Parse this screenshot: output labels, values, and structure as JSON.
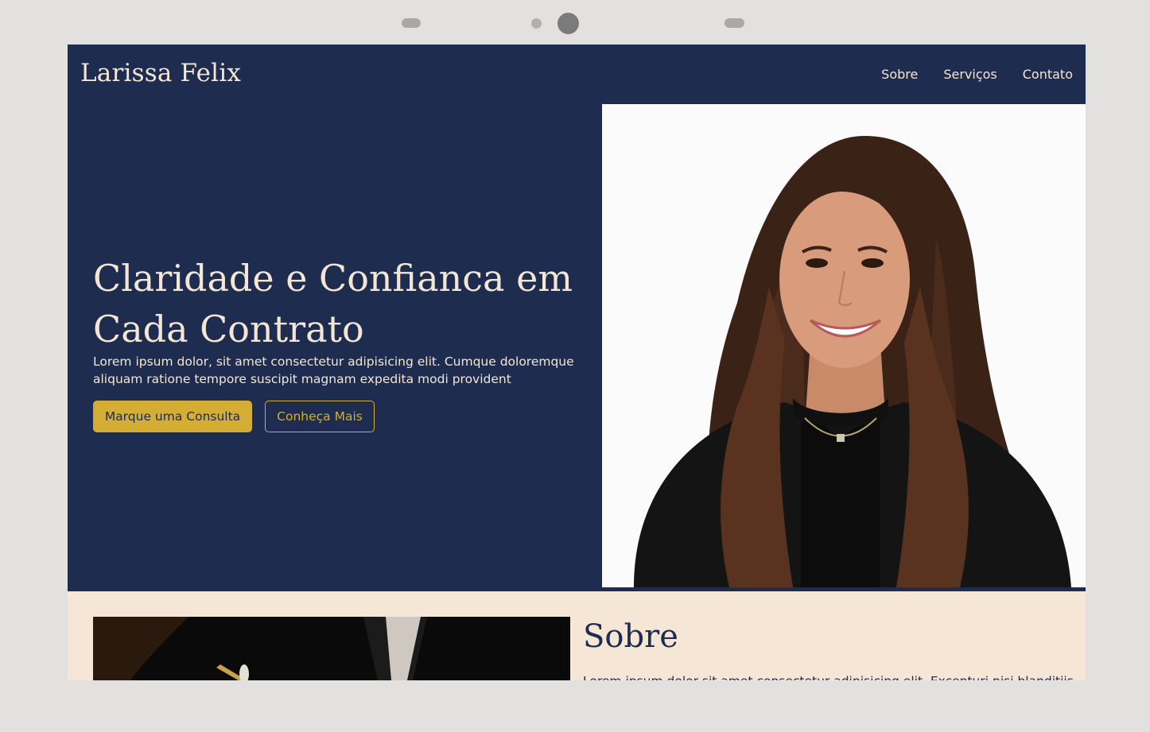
{
  "brand": "Larissa Felix",
  "nav": {
    "items": [
      "Sobre",
      "Serviços",
      "Contato"
    ]
  },
  "hero": {
    "title": "Claridade e Confianca em Cada Contrato",
    "text": "Lorem ipsum dolor, sit amet consectetur adipisicing elit. Cumque doloremque aliquam ratione tempore suscipit magnam expedita modi provident",
    "primary_button": "Marque uma Consulta",
    "secondary_button": "Conheça Mais"
  },
  "about": {
    "title": "Sobre",
    "text": "Lorem ipsum dolor sit amet consectetur adipisicing elit. Excepturi nisi blanditiis"
  },
  "colors": {
    "navy": "#1d2c4f",
    "gold": "#d4ae34",
    "cream": "#f4e6d5",
    "section_bg": "#f5e6d6"
  }
}
